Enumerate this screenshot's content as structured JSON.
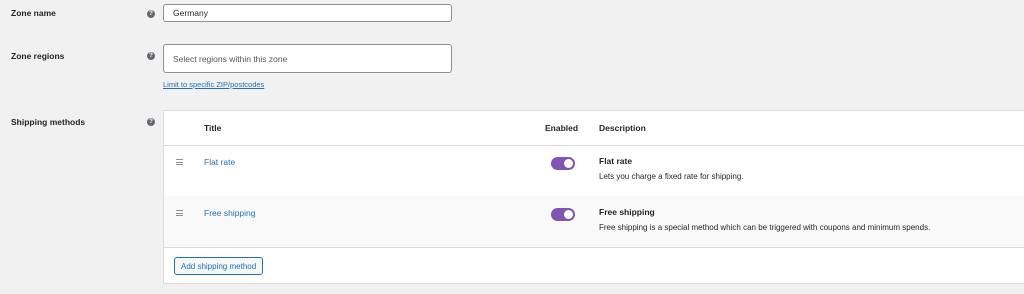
{
  "zone_name": {
    "label": "Zone name",
    "help_icon": "help-icon",
    "value": "Germany"
  },
  "zone_regions": {
    "label": "Zone regions",
    "help_icon": "help-icon",
    "placeholder": "Select regions within this zone",
    "limit_link": "Limit to specific ZIP/postcodes"
  },
  "shipping_methods": {
    "label": "Shipping methods",
    "help_icon": "help-icon",
    "columns": {
      "title": "Title",
      "enabled": "Enabled",
      "description": "Description"
    },
    "rows": [
      {
        "title": "Flat rate",
        "enabled": true,
        "desc_title": "Flat rate",
        "desc_text": "Lets you charge a fixed rate for shipping."
      },
      {
        "title": "Free shipping",
        "enabled": true,
        "desc_title": "Free shipping",
        "desc_text": "Free shipping is a special method which can be triggered with coupons and minimum spends."
      }
    ],
    "add_button": "Add shipping method"
  },
  "colors": {
    "accent_link": "#2271b1",
    "toggle_on": "#7f54b3",
    "background": "#f1f1f1"
  }
}
